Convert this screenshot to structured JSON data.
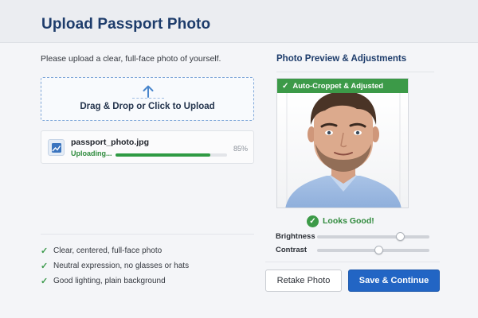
{
  "header": {
    "title": "Upload Passport Photo"
  },
  "upload": {
    "instructions": "Please upload a clear, full-face photo of yourself.",
    "dropzone_label": "Drag & Drop or Click to Upload",
    "file": {
      "name": "passport_photo.jpg",
      "status": "Uploading...",
      "progress_percent": 85,
      "progress_text": "85%"
    }
  },
  "requirements": [
    "Clear, centered, full-face photo",
    "Neutral expression, no glasses or hats",
    "Good lighting, plain background"
  ],
  "preview": {
    "title": "Photo Preview & Adjustments",
    "banner": "Auto-Croppet & Adjusted",
    "status": "Looks Good!"
  },
  "adjustments": {
    "brightness_label": "Brightness",
    "brightness_value": 0.74,
    "contrast_label": "Contrast",
    "contrast_value": 0.55
  },
  "actions": {
    "retake_label": "Retake Photo",
    "save_label": "Save & Continue"
  },
  "colors": {
    "brand": "#1d3c6b",
    "success": "#3c9a48",
    "primary_button": "#2265c4",
    "dropzone_border": "#7fa7d9"
  },
  "icons": [
    "upload-arrow-icon",
    "image-file-icon",
    "checkmark-icon",
    "check-circle-icon"
  ]
}
